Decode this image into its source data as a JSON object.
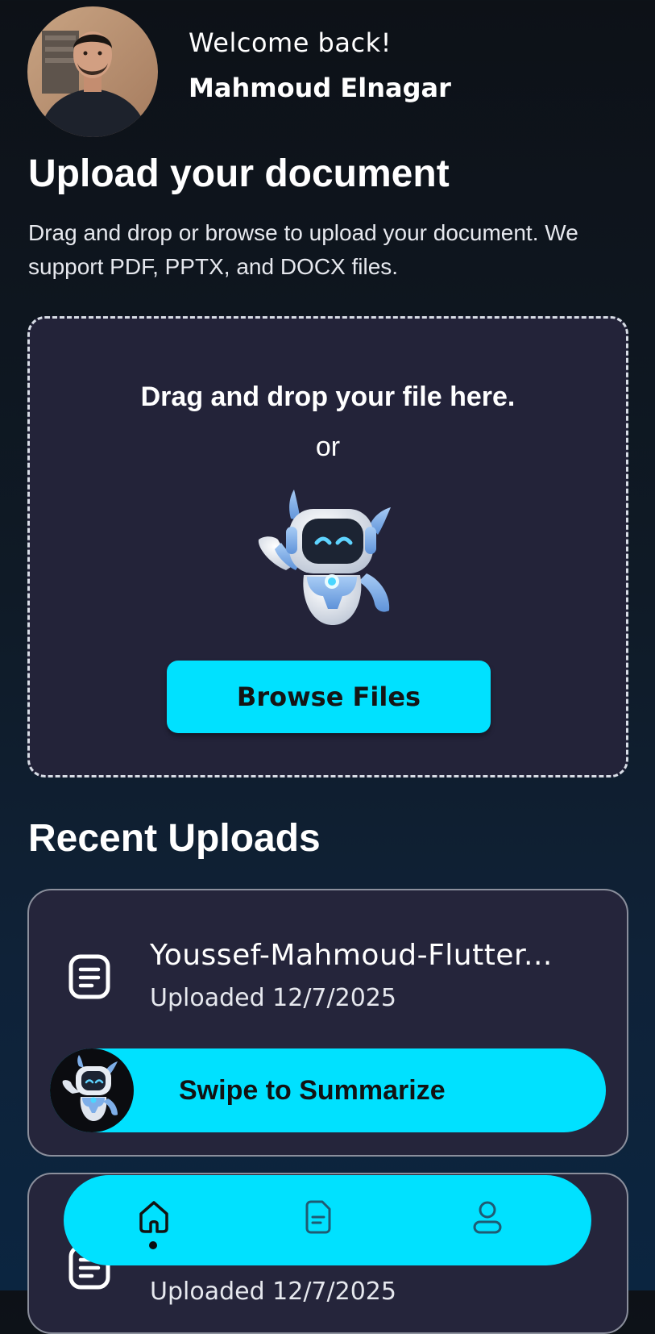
{
  "header": {
    "welcome": "Welcome back!",
    "user_name": "Mahmoud Elnagar"
  },
  "upload": {
    "title": "Upload your document",
    "description": "Drag and drop or browse to upload your document. We support PDF, PPTX, and DOCX files.",
    "drop_text": "Drag and drop your file here.",
    "or_text": "or",
    "browse_label": "Browse Files"
  },
  "recent": {
    "title": "Recent Uploads",
    "items": [
      {
        "file_name": "Youssef-Mahmoud-Flutter...",
        "uploaded": "Uploaded 12/7/2025",
        "action": "Swipe to Summarize"
      },
      {
        "file_name": "",
        "uploaded": "Uploaded 12/7/2025"
      }
    ]
  },
  "nav": {
    "items": [
      "home-icon",
      "document-icon",
      "profile-icon"
    ],
    "active": "home-icon"
  },
  "colors": {
    "accent": "#00e1ff",
    "card": "#25253b",
    "dropzone": "#232339",
    "background": "#0d1117"
  }
}
